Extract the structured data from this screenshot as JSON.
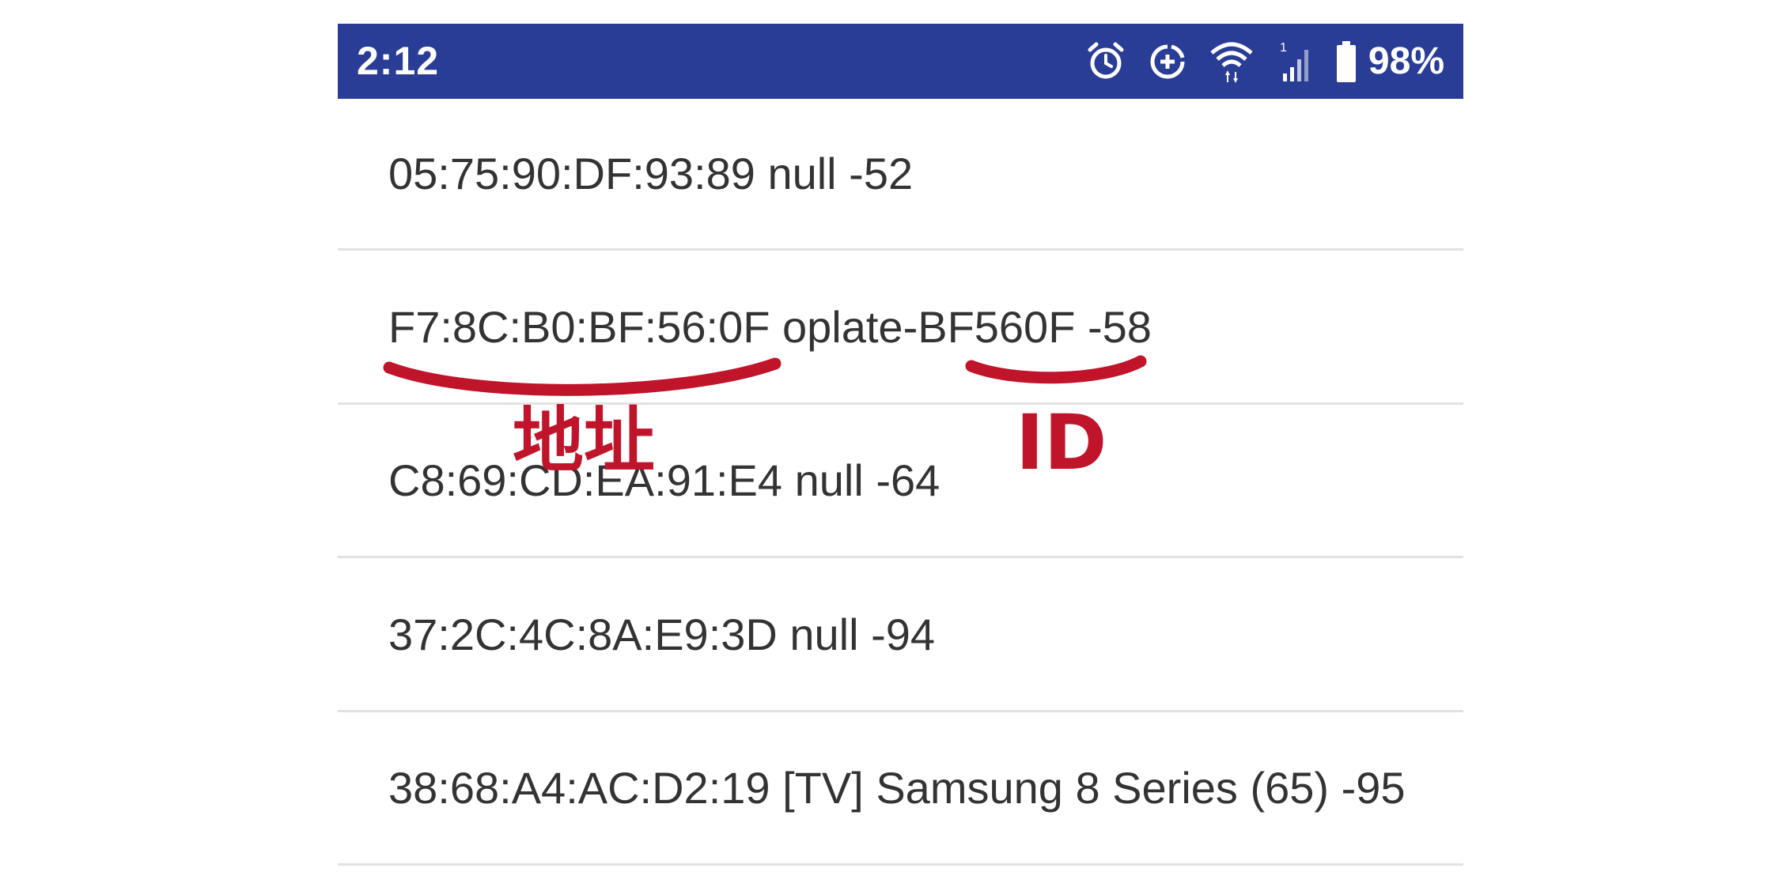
{
  "status_bar": {
    "time": "2:12",
    "battery_percent": "98%",
    "background_color": "#2a3d96",
    "icons": [
      "alarm-icon",
      "data-saver-icon",
      "wifi-icon",
      "cell-signal-icon",
      "battery-icon"
    ],
    "signal_label": "1"
  },
  "devices": [
    {
      "text": "05:75:90:DF:93:89 null -52"
    },
    {
      "text": "F7:8C:B0:BF:56:0F oplate-BF560F -58"
    },
    {
      "text": "C8:69:CD:EA:91:E4 null -64"
    },
    {
      "text": "37:2C:4C:8A:E9:3D null -94"
    },
    {
      "text": "38:68:A4:AC:D2:19 [TV] Samsung 8 Series (65) -95"
    }
  ],
  "annotations": {
    "address_label": "地址",
    "id_label": "ID",
    "color": "#c0142b"
  }
}
